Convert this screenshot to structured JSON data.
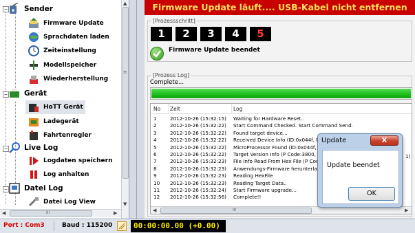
{
  "tree": {
    "items": [
      {
        "label": "Sender",
        "icon": "transmitter-icon"
      },
      {
        "label": "Firmware Update",
        "icon": "firmware-update-icon"
      },
      {
        "label": "Sprachdaten laden",
        "icon": "language-data-icon"
      },
      {
        "label": "Zeiteinstellung",
        "icon": "clock-icon"
      },
      {
        "label": "Modellspeicher",
        "icon": "model-memory-icon"
      },
      {
        "label": "Wiederherstellung",
        "icon": "restore-icon"
      },
      {
        "label": "Gerät",
        "icon": "device-icon"
      },
      {
        "label": "HoTT Gerät",
        "icon": "hott-device-icon"
      },
      {
        "label": "Ladegerät",
        "icon": "charger-icon"
      },
      {
        "label": "Fahrtenregler",
        "icon": "speed-controller-icon"
      },
      {
        "label": "Live Log",
        "icon": "live-log-icon"
      },
      {
        "label": "Logdaten speichern",
        "icon": "record-icon"
      },
      {
        "label": "Log anhalten",
        "icon": "stop-icon"
      },
      {
        "label": "Datei Log",
        "icon": "file-log-icon"
      },
      {
        "label": "Datei Log View",
        "icon": "file-log-view-icon"
      }
    ],
    "scroll_marker": "≡"
  },
  "banner": "Firmware Update läuft.... USB-Kabel nicht entfernen",
  "progress_section": {
    "title": "[Prozessschritt]",
    "steps": [
      "1",
      "2",
      "3",
      "4",
      "5"
    ],
    "active_step": "5",
    "done_text": "Firmware Update beendet"
  },
  "log_section": {
    "title": "[Prozess Log]",
    "complete_label": "Complete...",
    "progress": 1.0,
    "columns": [
      "No",
      "Zeit",
      "Log"
    ],
    "rows": [
      {
        "no": "1",
        "time": "2012-10-26 (15:32:15)",
        "log": "Waiting for Hardware Reset.."
      },
      {
        "no": "2",
        "time": "2012-10-26 (15:32:22)",
        "log": "Start Command Checked. Start Command Send."
      },
      {
        "no": "3",
        "time": "2012-10-26 (15:32:22)",
        "log": "Found target device..."
      },
      {
        "no": "4",
        "time": "2012-10-26 (15:32:22)",
        "log": "Received Device Info (ID:0x044f, PI:0"
      },
      {
        "no": "5",
        "time": "2012-10-26 (15:32:22)",
        "log": "MicroProcessor Found (ID:0x044f, PI:"
      },
      {
        "no": "6",
        "time": "2012-10-26 (15:32:22)",
        "log": "Target Version Info (P Code:3800, App"
      },
      {
        "no": "7",
        "time": "2012-10-26 (15:32:23)",
        "log": "File Info Read From Hex File (P Code:1"
      },
      {
        "no": "8",
        "time": "2012-10-26 (15:32:23)",
        "log": "Anwendungs-Firmware herunterladen"
      },
      {
        "no": "9",
        "time": "2012-10-26 (15:32:23)",
        "log": "Reading HexFile"
      },
      {
        "no": "10",
        "time": "2012-10-26 (15:32:23)",
        "log": "Reading Target Data.."
      },
      {
        "no": "11",
        "time": "2012-10-26 (15:32:24)",
        "log": "Start Firmware upgrade..."
      },
      {
        "no": "12",
        "time": "2012-10-26 (15:32:56)",
        "log": "Complete!!"
      }
    ],
    "overflow_fragment": "1)",
    "scroll_marker": "III"
  },
  "dialog": {
    "title": "Update",
    "message": "Update beendet",
    "ok_label": "OK",
    "close_label": "X"
  },
  "statusbar": {
    "port": "Port : Com3",
    "baud": "Baud : 115200",
    "timer": "00:00:00.00  (+0.00)"
  },
  "colors": {
    "banner_bg": "#c80000",
    "banner_text": "#ffe15a",
    "progress_green": "#20c01f",
    "active_step": "#ff3a30",
    "port_text": "#d40000",
    "timer_text": "#ffee00"
  }
}
